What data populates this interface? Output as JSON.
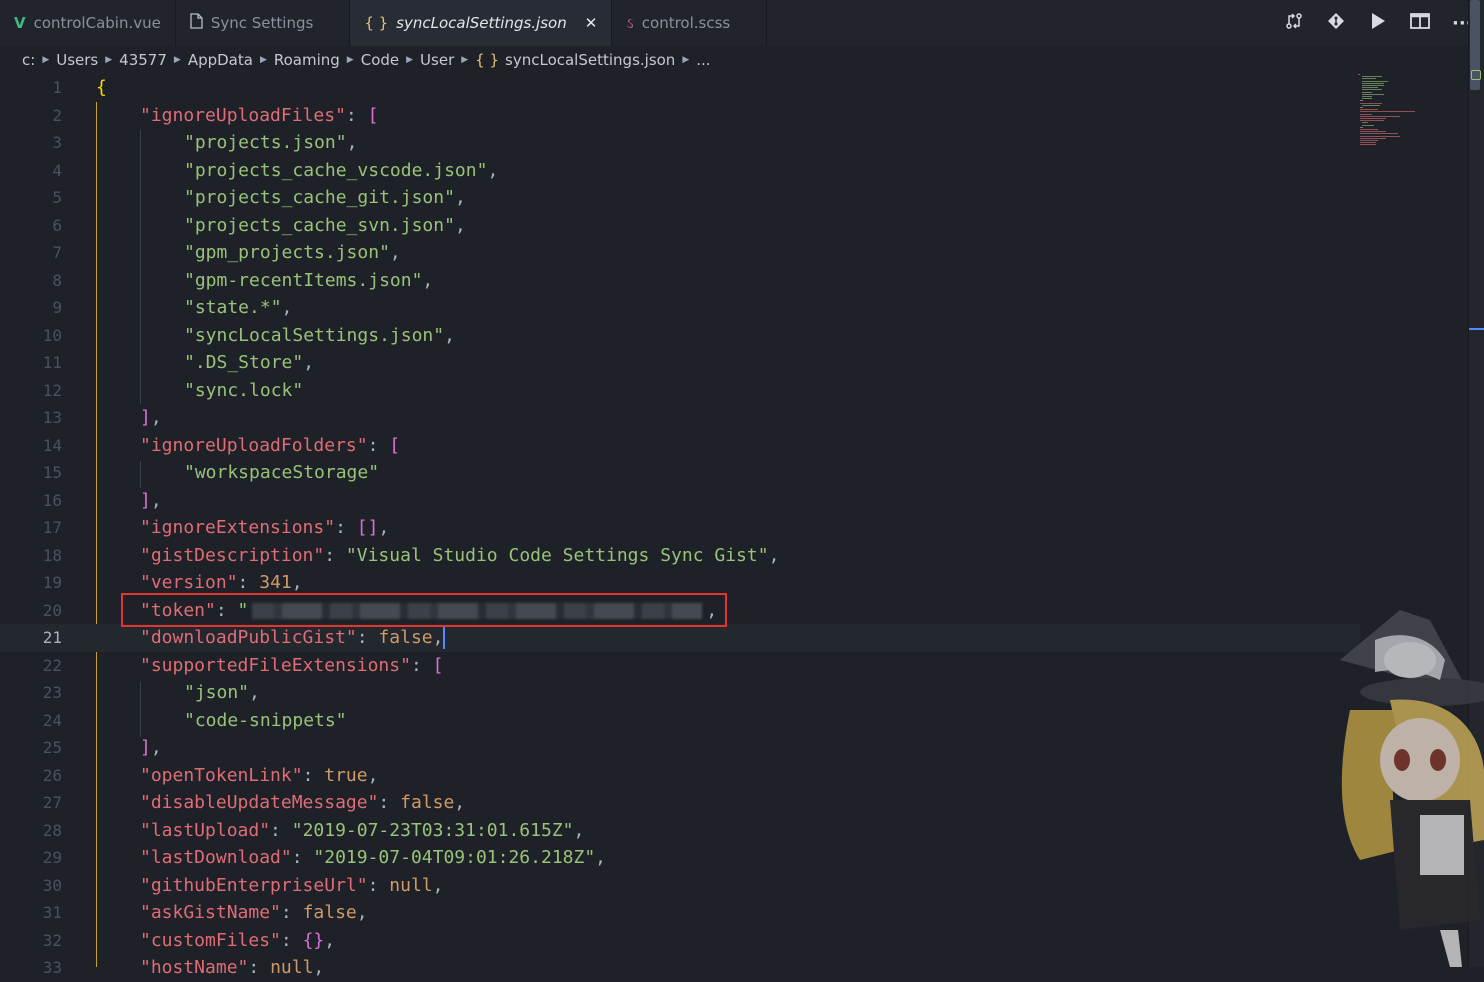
{
  "tabs": [
    {
      "label": "controlCabin.vue",
      "icon": "vue-icon",
      "icon_color": "#41b883"
    },
    {
      "label": "Sync Settings",
      "icon": "file-icon",
      "icon_color": "#b8bcc4"
    },
    {
      "label": "syncLocalSettings.json",
      "icon": "json-braces-icon",
      "icon_color": "#e5c07b",
      "active": true
    },
    {
      "label": "control.scss",
      "icon": "scss-icon",
      "icon_color": "#c6538c"
    }
  ],
  "tab_actions": [
    "compare-changes-icon",
    "source-control-icon",
    "run-icon",
    "split-editor-icon",
    "more-actions-icon"
  ],
  "breadcrumb": [
    "c:",
    "Users",
    "43577",
    "AppData",
    "Roaming",
    "Code",
    "User",
    "syncLocalSettings.json",
    "..."
  ],
  "editor": {
    "current_line": 21,
    "lines": [
      {
        "n": "1",
        "t": "{"
      },
      {
        "n": "2",
        "t": "\"ignoreUploadFiles\": ["
      },
      {
        "n": "3",
        "t": "\"projects.json\","
      },
      {
        "n": "4",
        "t": "\"projects_cache_vscode.json\","
      },
      {
        "n": "5",
        "t": "\"projects_cache_git.json\","
      },
      {
        "n": "6",
        "t": "\"projects_cache_svn.json\","
      },
      {
        "n": "7",
        "t": "\"gpm_projects.json\","
      },
      {
        "n": "8",
        "t": "\"gpm-recentItems.json\","
      },
      {
        "n": "9",
        "t": "\"state.*\","
      },
      {
        "n": "10",
        "t": "\"syncLocalSettings.json\","
      },
      {
        "n": "11",
        "t": "\".DS_Store\","
      },
      {
        "n": "12",
        "t": "\"sync.lock\""
      },
      {
        "n": "13",
        "t": "],"
      },
      {
        "n": "14",
        "t": "\"ignoreUploadFolders\": ["
      },
      {
        "n": "15",
        "t": "\"workspaceStorage\""
      },
      {
        "n": "16",
        "t": "],"
      },
      {
        "n": "17",
        "t": "\"ignoreExtensions\": [],"
      },
      {
        "n": "18",
        "t": "\"gistDescription\": \"Visual Studio Code Settings Sync Gist\","
      },
      {
        "n": "19",
        "t": "\"version\": 341,"
      },
      {
        "n": "20",
        "t": "\"token\": \""
      },
      {
        "n": "21",
        "t": "\"downloadPublicGist\": false,"
      },
      {
        "n": "22",
        "t": "\"supportedFileExtensions\": ["
      },
      {
        "n": "23",
        "t": "\"json\","
      },
      {
        "n": "24",
        "t": "\"code-snippets\""
      },
      {
        "n": "25",
        "t": "],"
      },
      {
        "n": "26",
        "t": "\"openTokenLink\": true,"
      },
      {
        "n": "27",
        "t": "\"disableUpdateMessage\": false,"
      },
      {
        "n": "28",
        "t": "\"lastUpload\": \"2019-07-23T03:31:01.615Z\","
      },
      {
        "n": "29",
        "t": "\"lastDownload\": \"2019-07-04T09:01:26.218Z\","
      },
      {
        "n": "30",
        "t": "\"githubEnterpriseUrl\": null,"
      },
      {
        "n": "31",
        "t": "\"askGistName\": false,"
      },
      {
        "n": "32",
        "t": "\"customFiles\": {},"
      },
      {
        "n": "33",
        "t": "\"hostName\": null,"
      }
    ]
  },
  "colors": {
    "key": "#e06c75",
    "string": "#98c379",
    "number": "#d19a66",
    "highlight_box": "#e3342f"
  }
}
